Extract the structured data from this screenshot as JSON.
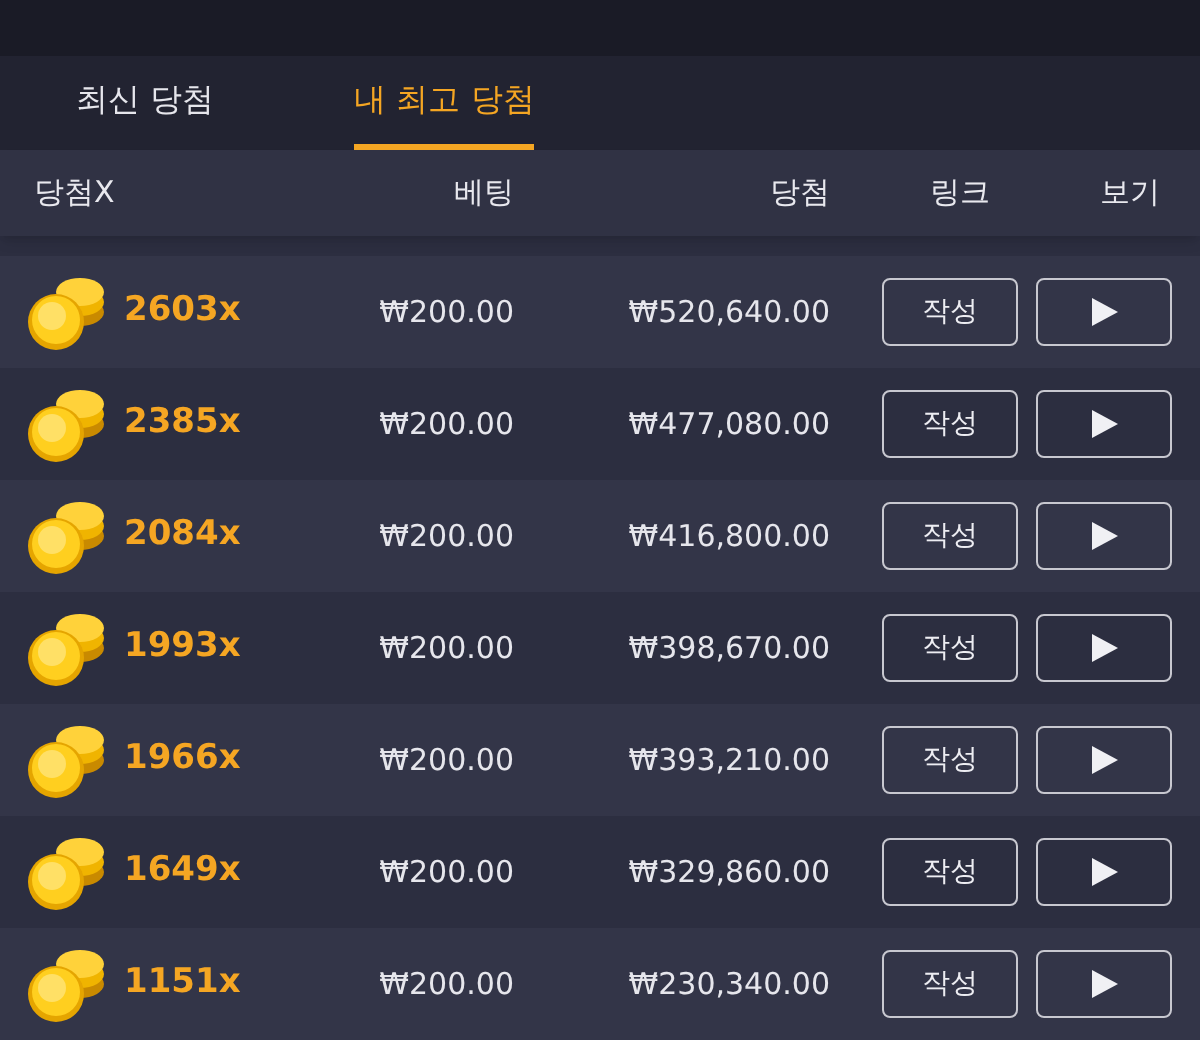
{
  "tabs": [
    {
      "label": "최신 당첨",
      "selected": false
    },
    {
      "label": "내 최고 당첨",
      "selected": true
    }
  ],
  "table": {
    "columns": [
      "당첨X",
      "베팅",
      "당첨",
      "링크",
      "보기"
    ],
    "rows": [
      {
        "multiplier": "2603x",
        "bet": "₩200.00",
        "win": "₩520,640.00",
        "link": "작성"
      },
      {
        "multiplier": "2385x",
        "bet": "₩200.00",
        "win": "₩477,080.00",
        "link": "작성"
      },
      {
        "multiplier": "2084x",
        "bet": "₩200.00",
        "win": "₩416,800.00",
        "link": "작성"
      },
      {
        "multiplier": "1993x",
        "bet": "₩200.00",
        "win": "₩398,670.00",
        "link": "작성"
      },
      {
        "multiplier": "1966x",
        "bet": "₩200.00",
        "win": "₩393,210.00",
        "link": "작성"
      },
      {
        "multiplier": "1649x",
        "bet": "₩200.00",
        "win": "₩329,860.00",
        "link": "작성"
      },
      {
        "multiplier": "1151x",
        "bet": "₩200.00",
        "win": "₩230,340.00",
        "link": "작성"
      }
    ]
  }
}
